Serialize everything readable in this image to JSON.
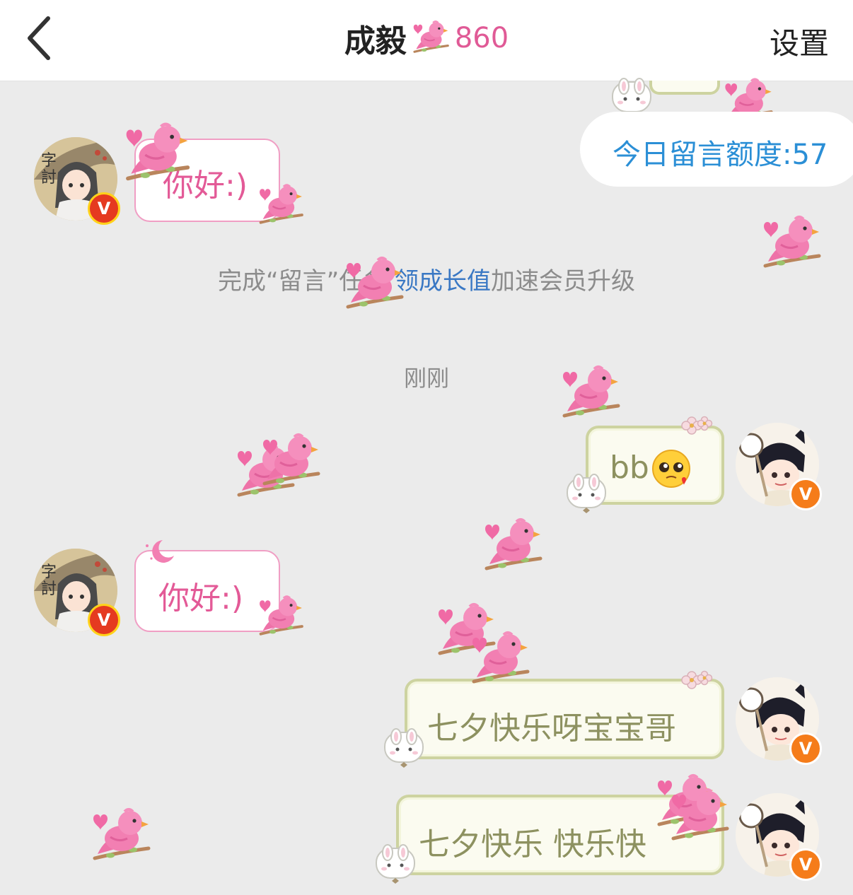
{
  "header": {
    "title": "成毅",
    "score": "860",
    "settings_label": "设置"
  },
  "quota": "今日留言额度:57",
  "messages": [
    {
      "side": "left",
      "text": "你好:)"
    },
    {
      "side": "right",
      "text": "bb"
    },
    {
      "side": "left",
      "text": "你好:)"
    },
    {
      "side": "right",
      "text": "七夕快乐呀宝宝哥"
    },
    {
      "side": "right",
      "text": "七夕快乐 快乐快"
    }
  ],
  "system_notice": {
    "prefix": "完成“留言”任务",
    "link": "领成长值",
    "suffix": "加速会员升级"
  },
  "timestamp": "刚刚",
  "badge_letter": "V",
  "colors": {
    "accent_pink": "#e35a97",
    "quota_blue": "#2b8fd6",
    "link_blue": "#3a78c4",
    "bubble_green_text": "#8d9160"
  },
  "icons": {
    "back": "chevron-left-icon",
    "bird": "pink-bird-icon",
    "emoji": "pleading-face-emoji-icon"
  }
}
